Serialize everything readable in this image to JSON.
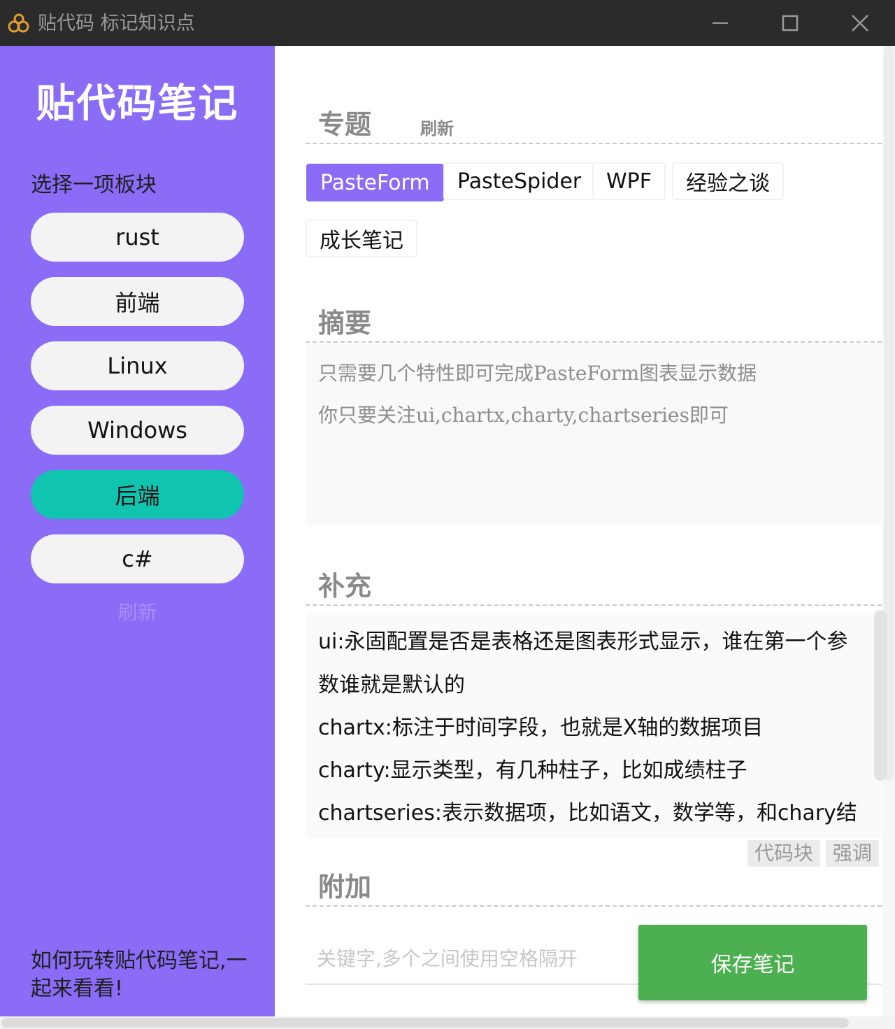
{
  "window": {
    "title": "贴代码 标记知识点",
    "icons": {
      "app": "link-logo-icon",
      "minimize": "minimize-icon",
      "maximize": "maximize-icon",
      "close": "close-icon"
    }
  },
  "sidebar": {
    "logo_title": "贴代码笔记",
    "section_label": "选择一项板块",
    "items": [
      {
        "label": "rust",
        "active": false
      },
      {
        "label": "前端",
        "active": false
      },
      {
        "label": "Linux",
        "active": false
      },
      {
        "label": "Windows",
        "active": false
      },
      {
        "label": "后端",
        "active": true
      },
      {
        "label": "c#",
        "active": false
      }
    ],
    "refresh_label": "刷新",
    "help_text": "如何玩转贴代码笔记,一起来看看!",
    "colors": {
      "background": "#8b6cf6",
      "active_item": "#10c4b0"
    }
  },
  "main": {
    "topics": {
      "title": "专题",
      "refresh_label": "刷新",
      "items": [
        {
          "label": "PasteForm",
          "active": true
        },
        {
          "label": "PasteSpider",
          "active": false
        },
        {
          "label": "WPF",
          "active": false
        },
        {
          "label": "经验之谈",
          "active": false
        },
        {
          "label": "成长笔记",
          "active": false
        }
      ]
    },
    "summary": {
      "title": "摘要",
      "lines": [
        "只需要几个特性即可完成PasteForm图表显示数据",
        "你只要关注ui,chartx,charty,chartseries即可"
      ]
    },
    "supplement": {
      "title": "补充",
      "lines": [
        "ui:永固配置是否是表格还是图表形式显示，谁在第一个参",
        "数谁就是默认的",
        "chartx:标注于时间字段，也就是X轴的数据项目",
        "charty:显示类型，有几种柱子，比如成绩柱子",
        "chartseries:表示数据项，比如语文，数学等，和chary结"
      ],
      "code_block_label": "代码块",
      "emphasis_label": "强调"
    },
    "extra": {
      "title": "附加",
      "keywords_placeholder": "关键字,多个之间使用空格隔开",
      "keywords_value": ""
    },
    "save_label": "保存笔记",
    "colors": {
      "accent": "#8b6cf6",
      "save": "#4caf50"
    }
  }
}
